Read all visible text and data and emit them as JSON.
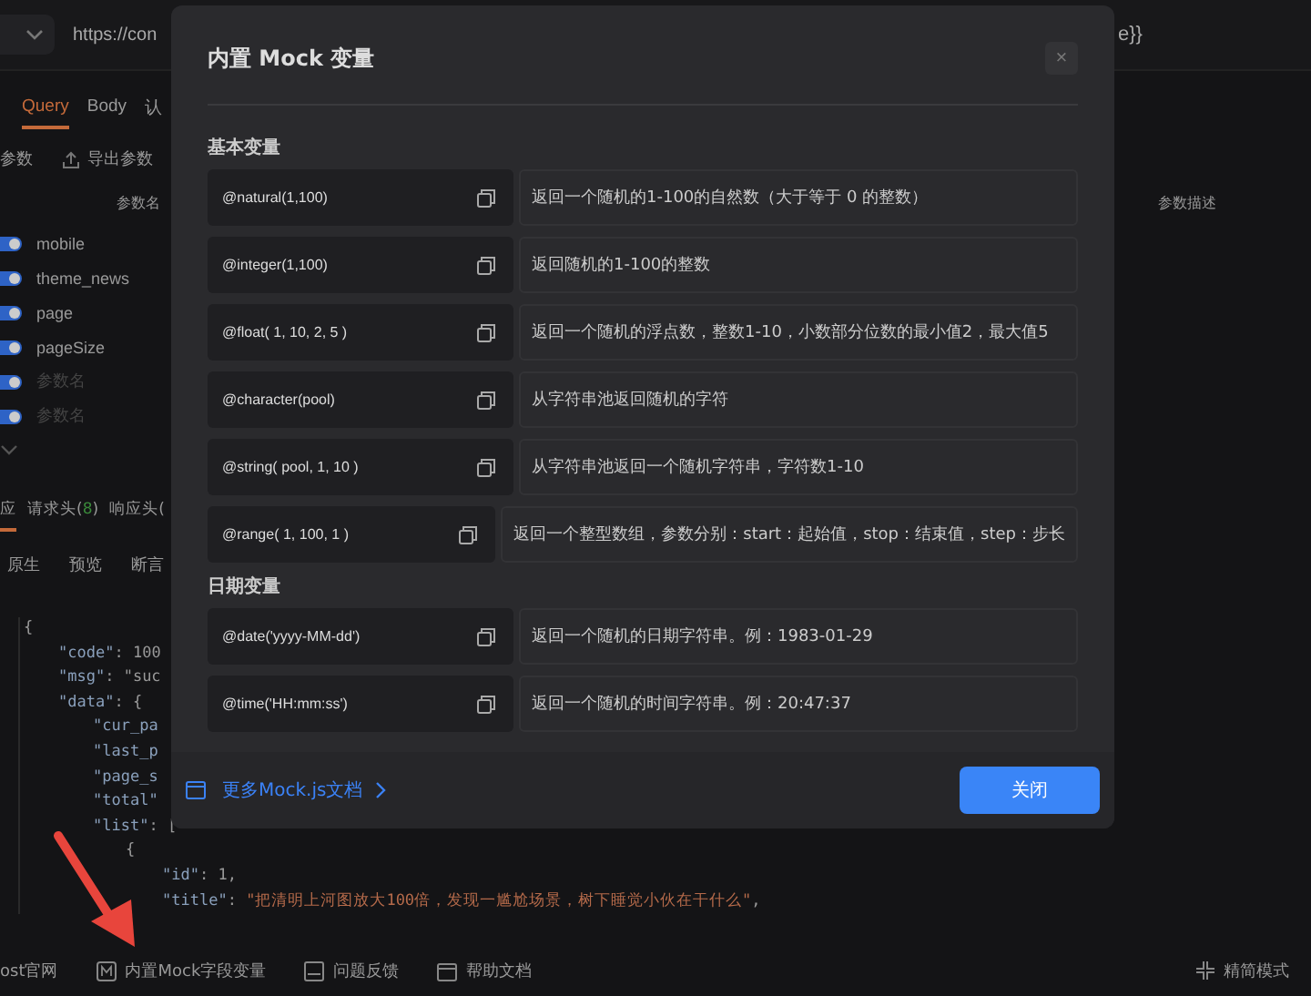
{
  "request": {
    "url_start": "https://con",
    "url_end": "e}}"
  },
  "request_tabs": [
    {
      "label": "Query",
      "selected": true
    },
    {
      "label": "Body",
      "selected": false
    },
    {
      "label": "认",
      "selected": false
    }
  ],
  "param_actions": [
    "参数",
    "导出参数"
  ],
  "param_columns": [
    "参数名",
    "参数描述"
  ],
  "params": [
    {
      "name": "mobile",
      "on": true,
      "placeholder": false
    },
    {
      "name": "theme_news",
      "on": true,
      "placeholder": false
    },
    {
      "name": "page",
      "on": true,
      "placeholder": false
    },
    {
      "name": "pageSize",
      "on": true,
      "placeholder": false
    },
    {
      "name": "参数名",
      "on": true,
      "placeholder": true
    },
    {
      "name": "参数名",
      "on": true,
      "placeholder": true
    }
  ],
  "response_tabs": [
    {
      "label": "应",
      "selected": true
    },
    {
      "label": "请求头(",
      "count": "8",
      "after": ")",
      "selected": false
    },
    {
      "label": "响应头(",
      "selected": false
    }
  ],
  "view_tabs": [
    "原生",
    "预览",
    "断言"
  ],
  "code": [
    {
      "text": "{",
      "children": [
        {
          "key": "\"code\"",
          "rest": ": 100"
        },
        {
          "key": "\"msg\"",
          "rest": ": \"suc"
        },
        {
          "key": "\"data\"",
          "rest": ": {",
          "children": [
            {
              "key": "\"cur_pa"
            },
            {
              "key": "\"last_p"
            },
            {
              "key": "\"page_s"
            },
            {
              "key": "\"total\""
            },
            {
              "key": "\"list\"",
              "rest": ": [",
              "children": [
                {
                  "text": "{",
                  "children": [
                    {
                      "key": "\"id\"",
                      "rest": ": 1,"
                    },
                    {
                      "key": "\"title\"",
                      "rest": ": ",
                      "str": "\"把清明上河图放大100倍，发现一尴尬场景，树下睡觉小伙在干什么\"",
                      "tail": ","
                    }
                  ]
                }
              ]
            }
          ]
        }
      ]
    }
  ],
  "footer_links": [
    "ost官网",
    "内置Mock字段变量",
    "问题反馈",
    "帮助文档"
  ],
  "footer_right": "精简模式",
  "modal": {
    "title": "内置 Mock 变量",
    "close": "×",
    "sections": [
      {
        "title": "基本变量",
        "items": [
          {
            "code": "@natural(1,100)",
            "desc": "返回一个随机的1-100的自然数（大于等于 0 的整数）"
          },
          {
            "code": "@integer(1,100)",
            "desc": "返回随机的1-100的整数"
          },
          {
            "code": "@float( 1, 10, 2, 5 )",
            "desc": "返回一个随机的浮点数，整数1-10，小数部分位数的最小值2，最大值5"
          },
          {
            "code": "@character(pool)",
            "desc": "从字符串池返回随机的字符"
          },
          {
            "code": "@string( pool, 1, 10 )",
            "desc": "从字符串池返回一个随机字符串，字符数1-10"
          },
          {
            "code": "@range( 1, 100, 1 )",
            "desc": "返回一个整型数组，参数分别：start：起始值，stop：结束值，step：步长"
          }
        ]
      },
      {
        "title": "日期变量",
        "items": [
          {
            "code": "@date('yyyy-MM-dd')",
            "desc": "返回一个随机的日期字符串。例：1983-01-29"
          },
          {
            "code": "@time('HH:mm:ss')",
            "desc": "返回一个随机的时间字符串。例：20:47:37"
          }
        ]
      }
    ],
    "doc_link": "更多Mock.js文档",
    "close_button": "关闭"
  }
}
